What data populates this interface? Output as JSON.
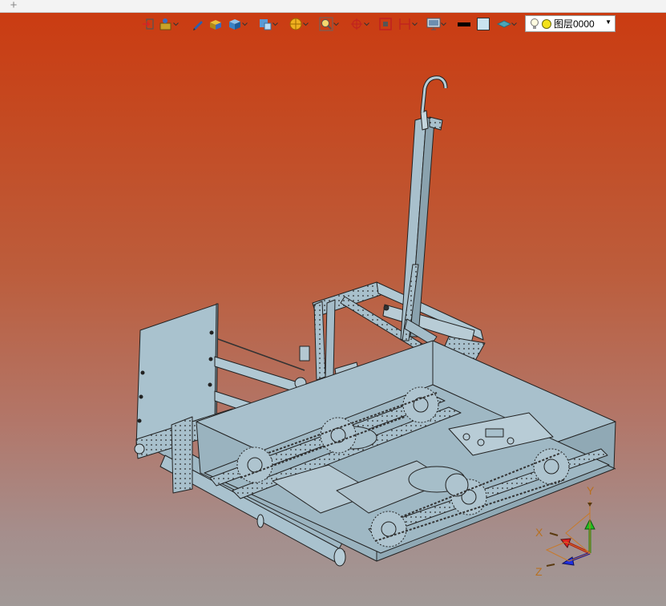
{
  "tabstrip": {
    "add_tab_symbol": "+"
  },
  "toolbar": {
    "buttons": [
      {
        "name": "exit-icon",
        "has_dropdown": false
      },
      {
        "name": "sketch-tools-icon",
        "has_dropdown": true
      },
      {
        "name": "pencil-icon",
        "has_dropdown": false
      },
      {
        "name": "box-yellow-icon",
        "has_dropdown": false
      },
      {
        "name": "solid-cube-icon",
        "has_dropdown": true
      },
      {
        "name": "view-orient-icon",
        "has_dropdown": true
      },
      {
        "name": "render-ball-icon",
        "has_dropdown": true
      },
      {
        "name": "zoom-fit-icon",
        "has_dropdown": true
      },
      {
        "name": "point-pick-icon",
        "has_dropdown": true
      },
      {
        "name": "section-view-icon",
        "has_dropdown": false
      },
      {
        "name": "dimension-icon",
        "has_dropdown": true
      },
      {
        "name": "display-monitor-icon",
        "has_dropdown": true
      },
      {
        "name": "line-color-swatch",
        "has_dropdown": false
      },
      {
        "name": "fill-color-swatch",
        "has_dropdown": false
      },
      {
        "name": "layer-plane-icon",
        "has_dropdown": true
      }
    ],
    "line_color": "#000000",
    "fill_color": "#c9e3ef"
  },
  "layer_selector": {
    "value": "图层0000",
    "icons": [
      "lightbulb-icon",
      "yellow-dot-icon"
    ]
  },
  "triad": {
    "x_label": "X",
    "y_label": "Y",
    "z_label": "Z",
    "x_color": "#e02020",
    "y_color": "#20c020",
    "z_color": "#2030e0"
  },
  "viewport": {
    "model": "robot-chassis-assembly",
    "model_color": "#a8c0cc",
    "background_top": "#cb3a10",
    "background_bottom": "#a19997"
  }
}
